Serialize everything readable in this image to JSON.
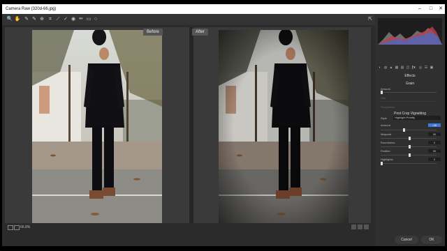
{
  "window": {
    "title": "Camera Raw (320d-66.jpg)"
  },
  "before_after": {
    "before_label": "Before",
    "after_label": "After"
  },
  "status": {
    "zoom": "66.8%"
  },
  "right_panel": {
    "section": "Effects",
    "grain": {
      "title": "Grain",
      "amount_label": "Amount",
      "size_label": "Size",
      "roughness_label": "Roughness"
    },
    "vignetting": {
      "title": "Post Crop Vignetting",
      "style_label": "Style",
      "style_value": "Highlight Priority",
      "amount_label": "Amount",
      "midpoint_label": "Midpoint",
      "roundness_label": "Roundness",
      "feather_label": "Feather",
      "highlights_label": "Highlights",
      "amount_value": "-18",
      "midpoint_value": "50",
      "roundness_value": "0",
      "feather_value": "50",
      "highlights_value": "0"
    }
  },
  "buttons": {
    "cancel": "Cancel",
    "ok": "OK"
  },
  "colors": {
    "accent": "#3d7ad8"
  }
}
